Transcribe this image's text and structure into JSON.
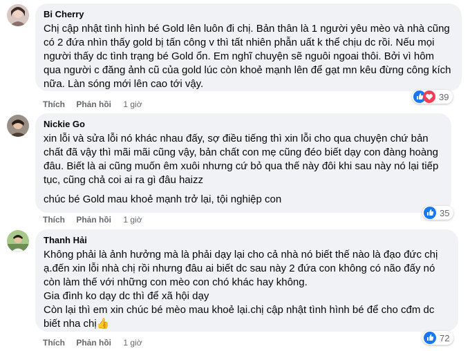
{
  "comments": [
    {
      "author": "Bi Cherry",
      "paragraphs": [
        "Chị cập nhật tình hình bé Gold lên luôn đi chị. Bản thân là 1 người yêu mèo và nhà cũng có 2 đứa nhìn thấy gold bị tấn công v thì tất nhiên phẫn uất k thể chịu dc rồi. Nếu mọi người thấy dc tình trạng bé Gold ổn. Em nghĩ chuyện sẽ nguôi ngoai thôi. Bởi vì hôm qua người c đăng ảnh cũ của gold lúc còn khoẻ mạnh lên để gạt mn kêu đừng công kích nữa. Làn sóng mới lên cao tới vậy."
      ],
      "like_label": "Thích",
      "reply_label": "Phản hồi",
      "time": "1 giờ",
      "reactions": [
        "like-icon",
        "love-icon"
      ],
      "reaction_count": "39"
    },
    {
      "author": "Nickie Go",
      "paragraphs": [
        "xin lỗi và sửa lỗi nó khác nhau đấy, sợ điều tiếng thì xin lỗi cho qua chuyện chứ bản chất đã vậy thì mãi mãi cũng vậy, bản chất con mẹ cũng đéo biết dạy con đàng hoàng đâu. Biết là ai cũng muốn êm xuôi nhưng cứ bỏ qua thế này đôi khi sau này nó lại tiếp tục, cũng chả coi ai ra gì đâu haizz",
        "chúc bé Gold mau khoẻ mạnh trở lại, tội nghiệp con"
      ],
      "like_label": "Thích",
      "reply_label": "Phản hồi",
      "time": "1 giờ",
      "reactions": [
        "like-icon"
      ],
      "reaction_count": "35"
    },
    {
      "author": "Thanh Hải",
      "paragraphs": [
        "Không phải là ảnh hưởng mà là phải dạy lại cho cả nhà nó biết thế nào là đạo đức chị ạ.đến xin lỗi nhà chị rồi nhưng đâu ai biết dc sau này 2 đứa con không có não đấy nó còn làm thế với những con mèo con chó khác hay không.",
        "Gia đình ko dạy dc thì để xã hội dạy",
        "Còn lại thì em xin chúc bé mèo mau khoẻ lại.chị cập nhật tình hình bé để cho cđm dc biết nha chị👍"
      ],
      "like_label": "Thích",
      "reply_label": "Phản hồi",
      "time": "1 giờ",
      "reactions": [
        "like-icon"
      ],
      "reaction_count": "72"
    }
  ],
  "colors": {
    "bubble": "#f0f2f5",
    "like_blue": "#1877f2",
    "love_red": "#f33e58",
    "meta_gray": "#65676b"
  }
}
